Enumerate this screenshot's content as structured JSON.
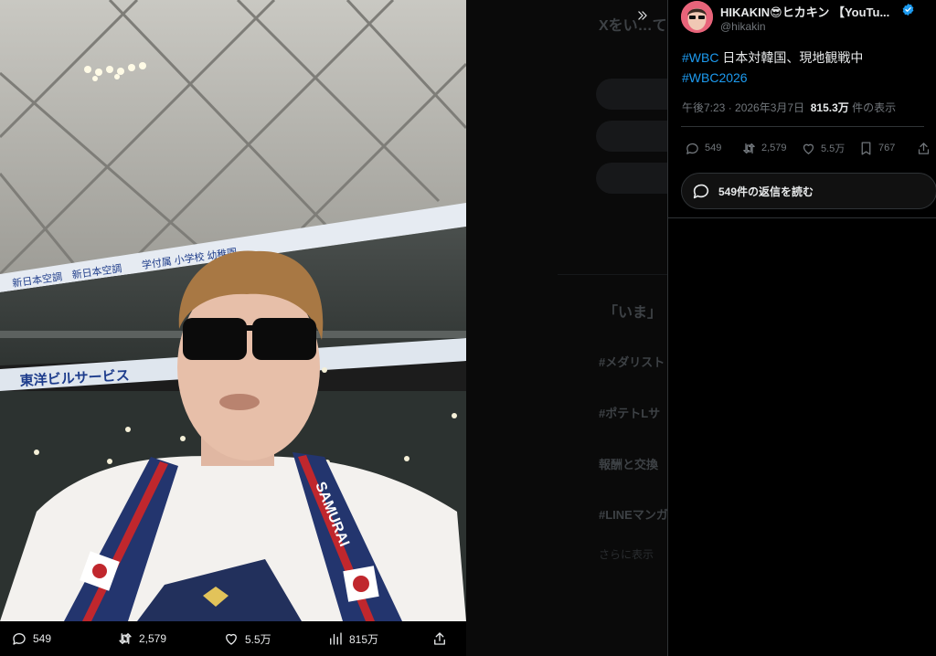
{
  "tweet": {
    "display_name": "HIKAKIN😎ヒカキン 【YouTu...",
    "handle": "@hikakin",
    "hashtag1": "#WBC",
    "text_rest": " 日本対韓国、現地観戦中",
    "hashtag2": "#WBC2026",
    "time": "午後7:23",
    "separator": " · ",
    "date": "2026年3月7日",
    "views_count": "815.3万",
    "views_label": " 件の表示",
    "replies": "549",
    "reposts": "2,579",
    "likes": "5.5万",
    "bookmarks": "767",
    "read_replies_label": "549件の返信を読む"
  },
  "media_actions": {
    "replies": "549",
    "reposts": "2,579",
    "likes": "5.5万",
    "views": "815万"
  },
  "photo": {
    "banner_upper": "新日本空調　新日本空調　　学付属 小学校 幼稚園",
    "banner_lower": "東洋ビルサービス",
    "scarf_text": "SAMURAI"
  },
  "backdrop": {
    "heading": "Xをい…て",
    "trending_title": "「いま」",
    "trends": [
      "#メダリスト",
      "#ポテトLサ",
      "報酬と交換",
      "#LINEマンガ"
    ],
    "show_more": "さらに表示"
  },
  "colors": {
    "accent": "#1d9bf0",
    "verified": "#1d9bf0",
    "muted_text": "#71767b",
    "background": "#000000"
  },
  "icons": {
    "reply": "speech-bubble-icon",
    "repost": "repost-arrows-icon",
    "like": "heart-icon",
    "views": "bar-chart-icon",
    "bookmark": "bookmark-icon",
    "share": "share-upload-icon",
    "expand": "double-chevron-right-icon",
    "verified": "verified-badge-icon"
  }
}
